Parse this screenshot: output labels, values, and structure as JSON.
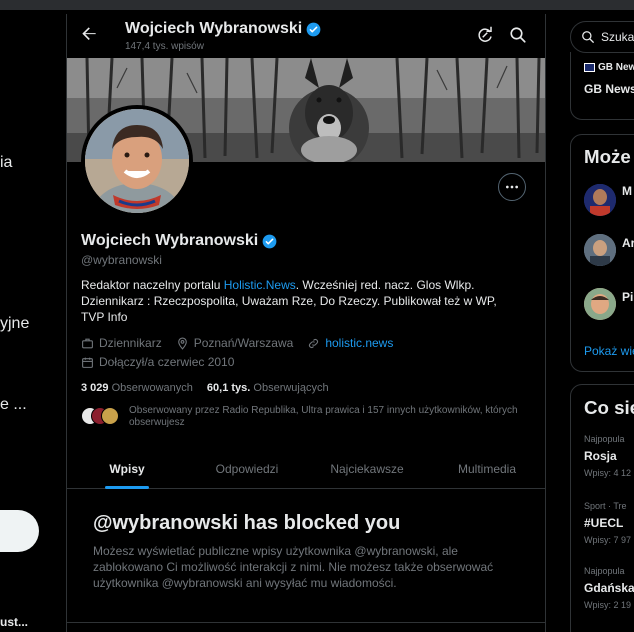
{
  "left_nav": {
    "frag1": "ia",
    "frag2": "yjne",
    "frag3": "e ...",
    "account_frag": "ust..."
  },
  "profile_header": {
    "name": "Wojciech Wybranowski",
    "post_count": "147,4 tys. wpisów"
  },
  "profile": {
    "name": "Wojciech Wybranowski",
    "handle": "@wybranowski",
    "bio": {
      "line1_pre": "Redaktor naczelny portalu ",
      "line1_link": "Holistic.News",
      "line1_post": ". Wcześniej red. nacz. Glos Wlkp.",
      "line2": "Dziennikarz : Rzeczpospolita, Uważam Rze, Do Rzeczy. Publikował też w WP, TVP Info"
    },
    "category": "Dziennikarz",
    "location": "Poznań/Warszawa",
    "website": "holistic.news",
    "joined": "Dołączył/a czerwiec 2010",
    "following_count": "3 029",
    "following_label": "Obserwowanych",
    "followers_count": "60,1 tys.",
    "followers_label": "Obserwujących",
    "followed_by_text": "Obserwowany przez Radio Republika, Ultra prawica i 157 innych użytkowników, których obserwujesz"
  },
  "tabs": [
    {
      "label": "Wpisy",
      "active": true
    },
    {
      "label": "Odpowiedzi",
      "active": false
    },
    {
      "label": "Najciekawsze",
      "active": false
    },
    {
      "label": "Multimedia",
      "active": false
    }
  ],
  "blocked": {
    "title": "@wybranowski has blocked you",
    "body": "Możesz wyświetlać publiczne wpisy użytkownika @wybranowski, ale zablokowano Ci możliwość interakcji z nimi. Nie możesz także obserwować użytkownika @wybranowski ani wysyłać mu wiadomości."
  },
  "right": {
    "search_placeholder": "Szukaj",
    "news_source": "GB New",
    "news_title": "GB News",
    "who_to_follow_title": "Może C",
    "suggest1": "M",
    "suggest2": "Ar",
    "suggest3": "Pi",
    "show_more": "Pokaż wie",
    "trends_title": "Co się",
    "trend1_cat": "Najpopula",
    "trend1_name": "Rosja",
    "trend1_count": "Wpisy: 4 12",
    "trend2_cat": "Sport · Tre",
    "trend2_name": "#UECL",
    "trend2_count": "Wpisy: 7 97",
    "trend3_cat": "Najpopula",
    "trend3_name": "Gdańska",
    "trend3_count": "Wpisy: 2 19"
  },
  "colors": {
    "accent": "#1d9bf0",
    "verified": "#1d9bf0",
    "muted_text": "#71767b",
    "border": "#2f3336",
    "background": "#000000"
  },
  "icons": [
    "back-arrow-icon",
    "verified-badge-icon",
    "refresh-icon",
    "search-icon",
    "more-icon",
    "briefcase-icon",
    "location-icon",
    "link-icon",
    "calendar-icon"
  ]
}
